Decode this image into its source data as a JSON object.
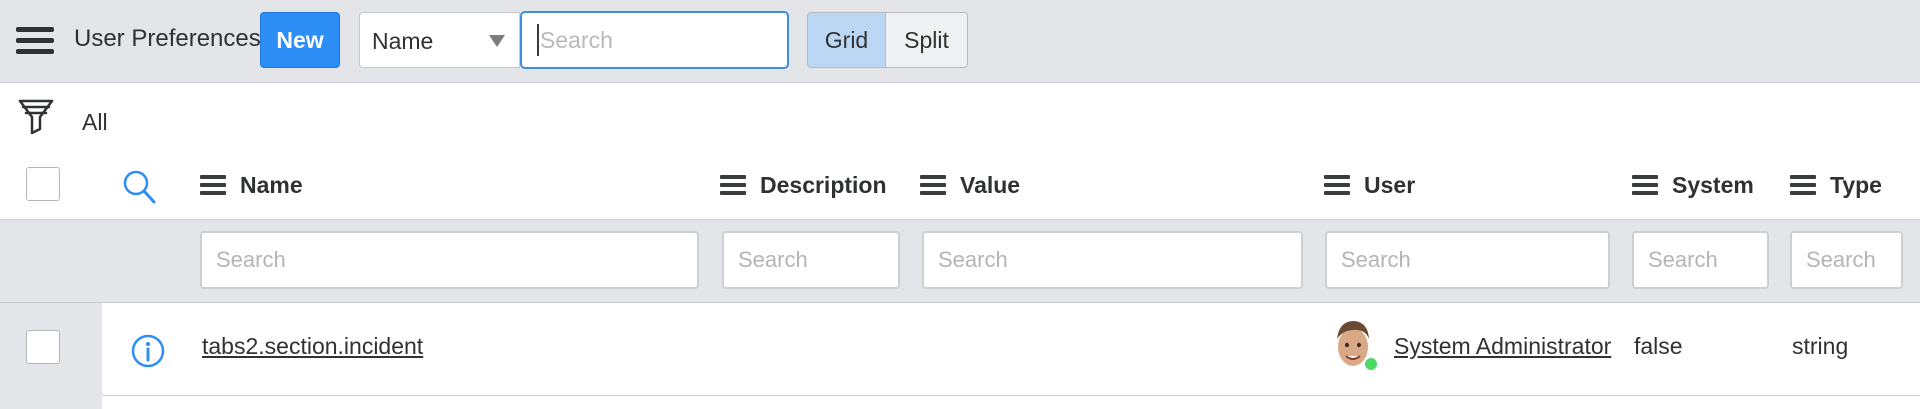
{
  "header": {
    "title": "User Preferences",
    "new_label": "New",
    "search_field": {
      "selected": "Name"
    },
    "search": {
      "value": "",
      "placeholder": "Search"
    },
    "view_toggle": {
      "grid_label": "Grid",
      "split_label": "Split",
      "active": "Grid"
    }
  },
  "filter": {
    "label": "All"
  },
  "columns": [
    {
      "label": "Name"
    },
    {
      "label": "Description"
    },
    {
      "label": "Value"
    },
    {
      "label": "User"
    },
    {
      "label": "System"
    },
    {
      "label": "Type"
    }
  ],
  "column_search": {
    "placeholder": "Search"
  },
  "rows": [
    {
      "name": "tabs2.section.incident",
      "description": "",
      "value": "",
      "user": "System Administrator",
      "user_status": "online",
      "system": "false",
      "type": "string"
    }
  ],
  "icons": {
    "menu": "hamburger-icon",
    "filter": "filter-funnel-icon",
    "search_toggle": "search-icon",
    "column_menu": "column-menu-icon",
    "row_info": "info-icon",
    "presence": "online-status-dot"
  },
  "colors": {
    "accent": "#2d8ef5",
    "focus": "#3b8fe0",
    "active_toggle": "#bcd7f3",
    "online": "#4cd964",
    "bar": "#e4e5e8"
  }
}
